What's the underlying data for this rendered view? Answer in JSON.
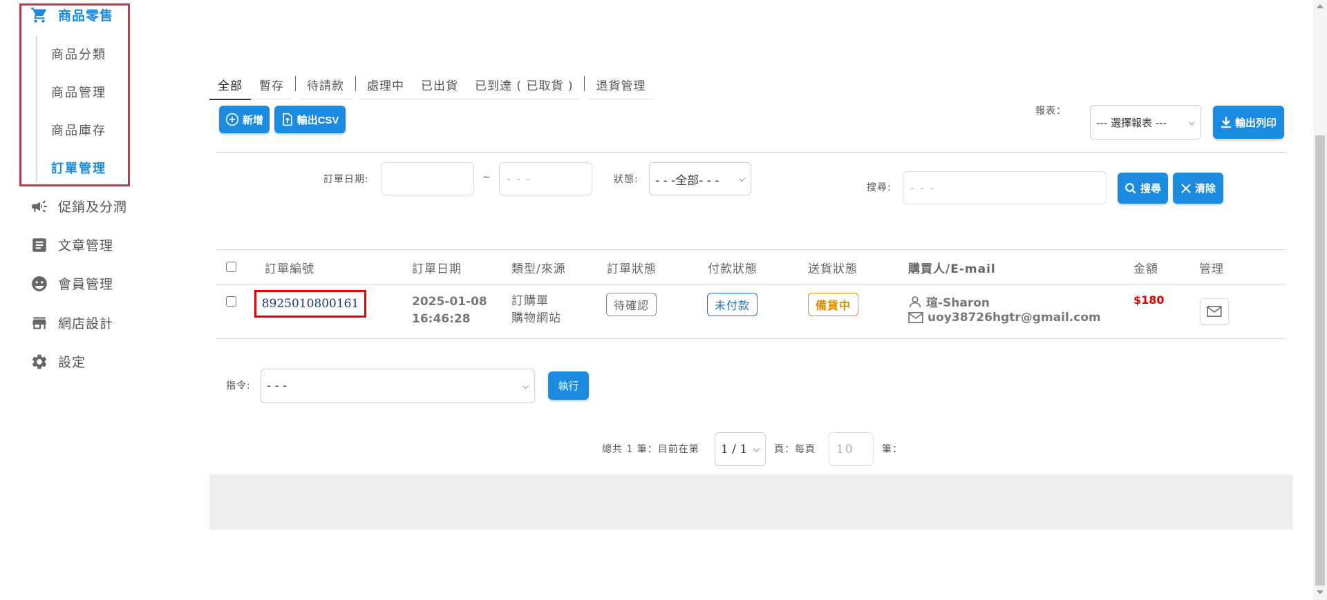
{
  "sidebar": {
    "main_active": "商品零售",
    "sub_items": [
      "商品分類",
      "商品管理",
      "商品庫存",
      "訂單管理"
    ],
    "main_items": [
      "促銷及分潤",
      "文章管理",
      "會員管理",
      "網店設計",
      "設定"
    ]
  },
  "tabs": [
    "全部",
    "暫存",
    "待請款",
    "處理中",
    "已出貨",
    "已到達 ( 已取貨 )",
    "退貨管理"
  ],
  "toolbar": {
    "add_label": "新增",
    "csv_label": "輸出CSV",
    "report_label": "報表：",
    "report_select": "--- 選擇報表 ---",
    "print_label": "輸出列印"
  },
  "filters": {
    "date_label": "訂單日期:",
    "date_sep": "~",
    "date_end_placeholder": "- - -",
    "status_label": "狀態:",
    "status_value": "- - -全部- - -",
    "search_label": "搜尋:",
    "search_placeholder": "- - -",
    "search_btn": "搜尋",
    "clear_btn": "清除"
  },
  "table": {
    "headers": [
      "訂單編號",
      "訂單日期",
      "類型/來源",
      "訂單狀態",
      "付款狀態",
      "送貨狀態",
      "購買人/E-mail",
      "金額",
      "管理"
    ],
    "rows": [
      {
        "order_no": "8925010800161",
        "date": "2025-01-08",
        "time": "16:46:28",
        "type": "訂購單",
        "source": "購物網站",
        "order_status": "待確認",
        "payment_status": "未付款",
        "delivery_status": "備貨中",
        "buyer": "瑄-Sharon",
        "email": "uoy38726hgtr@gmail.com",
        "amount": "$180"
      }
    ]
  },
  "command": {
    "label": "指令:",
    "value": "- - -",
    "execute_btn": "執行"
  },
  "pagination": {
    "total_text": "總共 1 筆：目前在第",
    "page_value": "1 / 1",
    "per_page_text": "頁：每頁",
    "per_page_value": "10",
    "unit_text": "筆："
  },
  "colors": {
    "accent": "#1a8be0",
    "highlight_red": "#e00000",
    "sidebar_box": "#b83a4b",
    "amount_red": "#e00000",
    "badge_unpaid": "#1a6fc4",
    "badge_preparing": "#e08a00"
  }
}
